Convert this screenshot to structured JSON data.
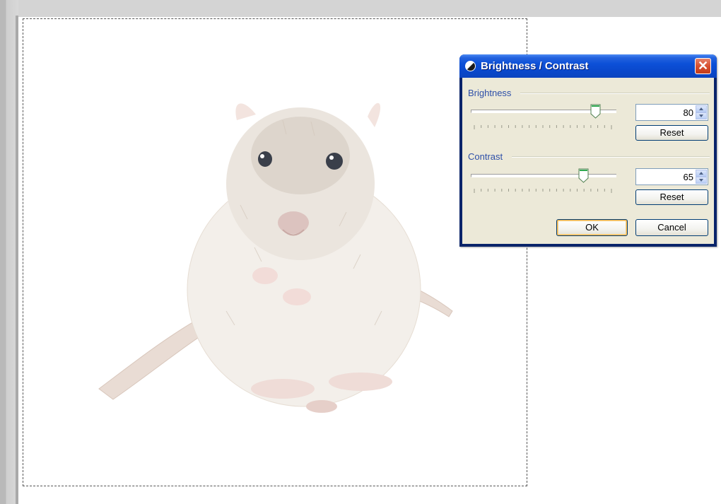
{
  "dialog": {
    "title": "Brightness / Contrast",
    "close_symbol": "✕",
    "brightness": {
      "label": "Brightness",
      "value": "80",
      "slider_fraction": 0.89,
      "reset_label": "Reset"
    },
    "contrast": {
      "label": "Contrast",
      "value": "65",
      "slider_fraction": 0.8,
      "reset_label": "Reset"
    },
    "ok_label": "OK",
    "cancel_label": "Cancel"
  },
  "icons": {
    "dialog_icon": "brightness-contrast-icon",
    "close": "close-icon",
    "slider_thumb": "slider-thumb-icon",
    "spin_up": "chevron-up-icon",
    "spin_down": "chevron-down-icon"
  },
  "colors": {
    "titlebar": "#0c50d8",
    "dialog_face": "#ece9d8",
    "group_label": "#2d4fa8",
    "close_button": "#d8502f",
    "slider_thumb_accent": "#2fa84f"
  }
}
